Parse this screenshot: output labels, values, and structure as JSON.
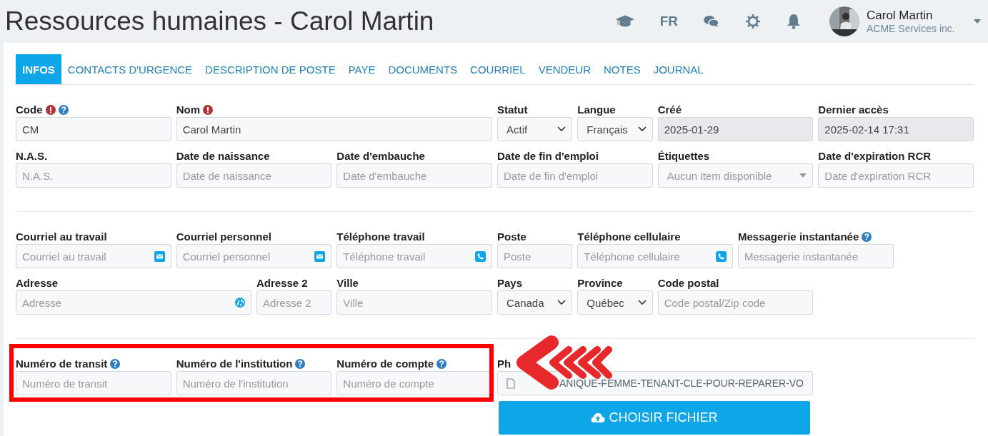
{
  "header": {
    "title": "Ressources humaines - Carol Martin",
    "language": "FR",
    "user_name": "Carol Martin",
    "company": "ACME Services inc."
  },
  "tabs": [
    {
      "label": "INFOS",
      "selected": true
    },
    {
      "label": "CONTACTS D'URGENCE",
      "selected": false
    },
    {
      "label": "DESCRIPTION DE POSTE",
      "selected": false
    },
    {
      "label": "PAYE",
      "selected": false
    },
    {
      "label": "DOCUMENTS",
      "selected": false
    },
    {
      "label": "COURRIEL",
      "selected": false
    },
    {
      "label": "VENDEUR",
      "selected": false
    },
    {
      "label": "NOTES",
      "selected": false
    },
    {
      "label": "JOURNAL",
      "selected": false
    }
  ],
  "sections": [
    {
      "highlighted": false,
      "fields": [
        {
          "label": "Code",
          "kind": "text",
          "value": "CM",
          "required": true,
          "help": true
        },
        {
          "label": "Nom",
          "kind": "text",
          "value": "Carol Martin",
          "required": true,
          "help": false
        },
        {
          "label": "Statut",
          "kind": "select",
          "value": "Actif"
        },
        {
          "label": "Langue",
          "kind": "select",
          "value": "Français"
        },
        {
          "label": "Créé",
          "kind": "readonly",
          "value": "2025-01-29"
        },
        {
          "label": "Dernier accès",
          "kind": "readonly",
          "value": "2025-02-14 17:31"
        },
        {
          "label": "N.A.S.",
          "kind": "text",
          "placeholder": "N.A.S."
        },
        {
          "label": "Date de naissance",
          "kind": "text",
          "placeholder": "Date de naissance"
        },
        {
          "label": "Date d'embauche",
          "kind": "text",
          "placeholder": "Date d'embauche"
        },
        {
          "label": "Date de fin d'emploi",
          "kind": "text",
          "placeholder": "Date de fin d'emploi"
        },
        {
          "label": "Étiquettes",
          "kind": "tags",
          "placeholder": "Aucun item disponible"
        },
        {
          "label": "Date d'expiration RCR",
          "kind": "text",
          "placeholder": "Date d'expiration RCR"
        }
      ]
    },
    {
      "highlighted": false,
      "fields": [
        {
          "label": "Courriel au travail",
          "kind": "email",
          "placeholder": "Courriel au travail"
        },
        {
          "label": "Courriel personnel",
          "kind": "email",
          "placeholder": "Courriel personnel"
        },
        {
          "label": "Téléphone travail",
          "kind": "phone",
          "placeholder": "Téléphone travail"
        },
        {
          "label": "Poste",
          "kind": "text",
          "placeholder": "Poste"
        },
        {
          "label": "Téléphone cellulaire",
          "kind": "phone",
          "placeholder": "Téléphone cellulaire"
        },
        {
          "label": "Messagerie instantanée",
          "kind": "text",
          "placeholder": "Messagerie instantanée",
          "help": true
        },
        {
          "label": "Adresse",
          "kind": "address",
          "placeholder": "Adresse"
        },
        {
          "label": "Adresse 2",
          "kind": "text",
          "placeholder": "Adresse 2"
        },
        {
          "label": "Ville",
          "kind": "text",
          "placeholder": "Ville"
        },
        {
          "label": "Pays",
          "kind": "select",
          "value": "Canada"
        },
        {
          "label": "Province",
          "kind": "select",
          "value": "Québec"
        },
        {
          "label": "Code postal",
          "kind": "text",
          "placeholder": "Code postal/Zip code"
        }
      ]
    },
    {
      "highlighted": true,
      "fields": [
        {
          "label": "Numéro de transit",
          "kind": "text",
          "placeholder": "Numéro de transit",
          "help": true
        },
        {
          "label": "Numéro de l'institution",
          "kind": "text",
          "placeholder": "Numéro de l'institution",
          "help": true
        },
        {
          "label": "Numéro de compte",
          "kind": "text",
          "placeholder": "Numéro de compte",
          "help": true
        }
      ]
    }
  ],
  "photo": {
    "label": "Ph",
    "file_name": "ANIQUE-FEMME-TENANT-CLE-POUR-REPARER-VO",
    "button": "CHOISIR FICHIER"
  }
}
